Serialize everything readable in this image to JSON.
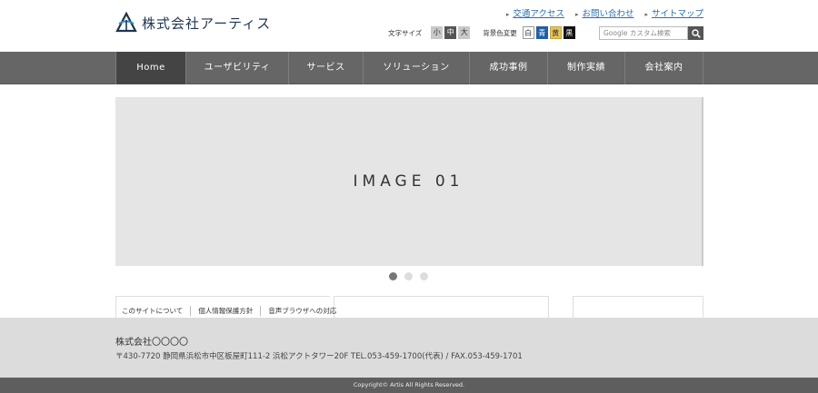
{
  "header": {
    "logo_text": "株式会社アーティス",
    "util_links": [
      "交通アクセス",
      "お問い合わせ",
      "サイトマップ"
    ],
    "font_size_label": "文字サイズ",
    "font_sizes": [
      "小",
      "中",
      "大"
    ],
    "bg_color_label": "背景色変更",
    "bg_colors": [
      "白",
      "青",
      "黄",
      "黒"
    ],
    "search_placeholder": "Google カスタム検索"
  },
  "nav": {
    "items": [
      "Home",
      "ユーザビリティ",
      "サービス",
      "ソリューション",
      "成功事例",
      "制作実績",
      "会社案内"
    ],
    "active": "Home"
  },
  "slider": {
    "text": "IMAGE 01",
    "dot_count": 3,
    "active_dot": 1
  },
  "footer": {
    "links": [
      "このサイトについて",
      "個人情報保護方針",
      "音声ブラウザへの対応"
    ],
    "company": "株式会社〇〇〇〇",
    "address": "〒430-7720 静岡県浜松市中区板屋町111-2 浜松アクトタワー20F TEL.053-459-1700(代表) / FAX.053-459-1701",
    "copyright": "Copyright© Artis All Rights Reserved."
  },
  "colors": {
    "nav_bg": "#666666",
    "nav_active": "#444444",
    "link": "#2c6fb0",
    "footer_bg": "#dcdcdc",
    "copyright_bg": "#5e5e5e"
  }
}
